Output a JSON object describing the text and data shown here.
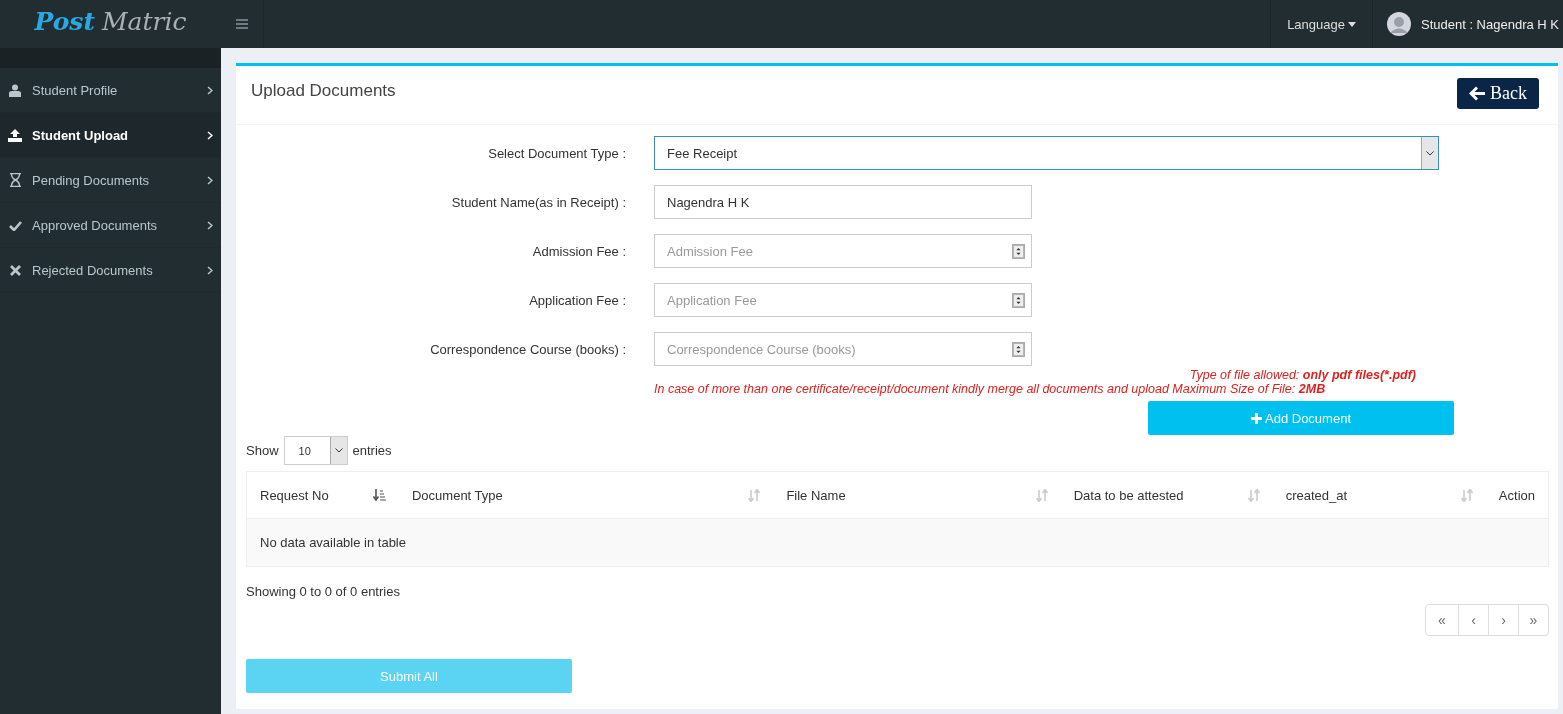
{
  "header": {
    "logo_parts": [
      "Post",
      "Matric"
    ],
    "language": "Language",
    "user": "Student : Nagendra H K"
  },
  "sidebar": {
    "items": [
      {
        "label": "Student Profile",
        "selected": false
      },
      {
        "label": "Student Upload",
        "selected": true
      },
      {
        "label": "Pending Documents",
        "selected": false
      },
      {
        "label": "Approved Documents",
        "selected": false
      },
      {
        "label": "Rejected Documents",
        "selected": false
      }
    ]
  },
  "panel": {
    "title": "Upload Documents",
    "back_button": "Back",
    "form": [
      {
        "kind": "select",
        "label": "Select Document Type :",
        "value": "Fee Receipt"
      },
      {
        "kind": "text",
        "label": "Student Name(as in Receipt) :",
        "value": "Nagendra H K"
      },
      {
        "kind": "number",
        "label": "Admission Fee :",
        "placeholder": "Admission Fee"
      },
      {
        "kind": "number",
        "label": "Application Fee :",
        "placeholder": "Application Fee"
      },
      {
        "kind": "number",
        "label": "Correspondence Course (books) :",
        "placeholder": "Correspondence Course (books)"
      }
    ],
    "file_type_note": "Type of file allowed: **only pdf files(*.pdf)**",
    "merge_note": "In case of more than one certificate/receipt/document kindly merge all documents and upload Maximum Size of File: **2MB**",
    "add_button": "Add Document",
    "length": {
      "before": "Show",
      "value": "10",
      "after": "entries"
    },
    "table": {
      "columns": [
        {
          "label": "Request No",
          "kind": "sorted"
        },
        {
          "label": "Document Type",
          "kind": "sortable"
        },
        {
          "label": "File Name",
          "kind": "sortable"
        },
        {
          "label": "Data to be attested",
          "kind": "sortable"
        },
        {
          "label": "created_at",
          "kind": "sortable"
        },
        {
          "label": "Action",
          "kind": "plain"
        }
      ],
      "empty": "No data available in table"
    },
    "info": "Showing 0 to 0 of 0 entries",
    "pagination": [
      "«",
      "‹",
      "›",
      "»"
    ],
    "submit_button": "Submit All"
  }
}
